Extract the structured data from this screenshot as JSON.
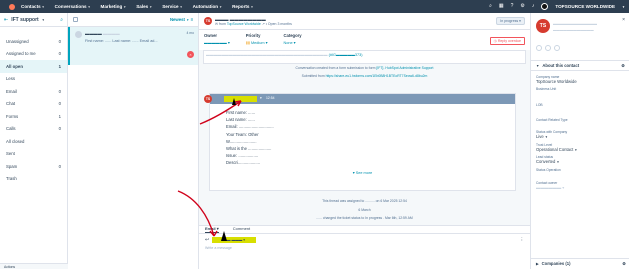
{
  "nav": {
    "items": [
      "Contacts",
      "Conversations",
      "Marketing",
      "Sales",
      "Service",
      "Automation",
      "Reports"
    ],
    "company": "TOPSOURCE WORLDWIDE"
  },
  "inbox": {
    "title": "IFT support",
    "filters": [
      {
        "label": "Unassigned",
        "count": "0"
      },
      {
        "label": "Assigned to me",
        "count": "0"
      },
      {
        "label": "All open",
        "count": "1"
      },
      {
        "label": "Less",
        "count": ""
      },
      {
        "label": "Email",
        "count": "0"
      },
      {
        "label": "Chat",
        "count": "0"
      },
      {
        "label": "Forms",
        "count": "1"
      },
      {
        "label": "Calls",
        "count": "0"
      },
      {
        "label": "All closed",
        "count": ""
      },
      {
        "label": "Sent",
        "count": ""
      },
      {
        "label": "Spam",
        "count": "0"
      },
      {
        "label": "Trash",
        "count": ""
      }
    ],
    "footer": "Actions"
  },
  "list": {
    "sort_label": "Newest",
    "card": {
      "time": "4 mo",
      "preview": "First name: ...... Last name: ...... Email ad..."
    }
  },
  "thread": {
    "from_prefix": "from",
    "from_inbox": "TopSource Worldwide",
    "open_text": "Open 3 months",
    "status_button": "In progress",
    "owner_label": "Owner",
    "priority_label": "Priority",
    "priority_value": "Medium",
    "category_label": "Category",
    "category_value": "None",
    "reply_overdue": "Reply overdue",
    "sys1_prefix": "Conversation created from a form submission to form",
    "sys1_link": "[IFT]- HubSpot Administrative Support",
    "sys2_prefix": "Submitted from",
    "sys2_link": "https://share-eu1.hsforms.com/1Eb0B8H1BTEoRT7Seow6-d8bu2m",
    "email_time": "12:54",
    "email_fields": [
      "First name: ......",
      "Last name: ......",
      "Email: ..............................",
      "Your Team: Other",
      "W.......................",
      "What is the ....................",
      "Issue: .................",
      "Descri..................."
    ],
    "see_more": "See more",
    "sys3": "This thread was assigned to .......... on 6 Mar 2025 12:54",
    "sys4_date": "6 March",
    "sys5": "...... changed the ticket status to  In progress  . Mar 6th, 12:59 AM"
  },
  "composer": {
    "tab_email": "Email",
    "tab_comment": "Comment",
    "placeholder": "Write a message"
  },
  "sidebar": {
    "about_title": "About this contact",
    "fields": [
      {
        "label": "Company name",
        "value": "TopSource Worldwide"
      },
      {
        "label": "Business Unit",
        "value": ""
      },
      {
        "label": "LOB",
        "value": ""
      },
      {
        "label": "Contact Related Type",
        "value": ""
      },
      {
        "label": "Status with Company",
        "value": "Live"
      },
      {
        "label": "Trust Level",
        "value": "Operational Contact"
      },
      {
        "label": "Lead status",
        "value": "Converted"
      },
      {
        "label": "Status Operation",
        "value": ""
      },
      {
        "label": "Contact owner",
        "value": ""
      }
    ],
    "companies": "Companies (1)"
  },
  "colors": {
    "nav_bg": "#2d3e50",
    "highlight": "#d8df00",
    "accent": "#00a4bd",
    "arrow": "#d0021b"
  }
}
